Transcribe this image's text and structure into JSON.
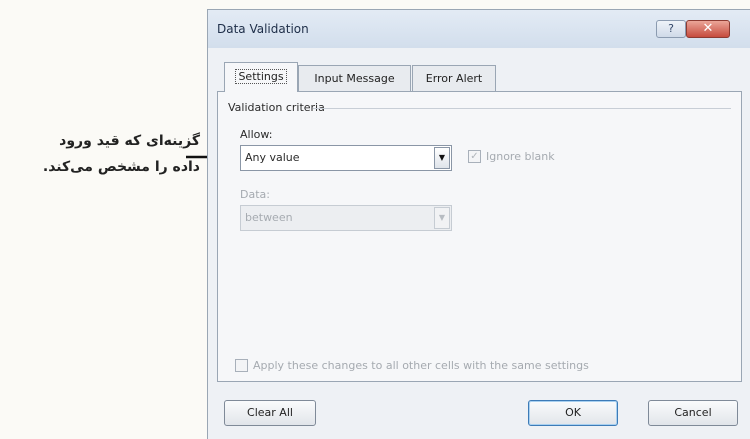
{
  "annotation": {
    "lines": [
      "گزینه‌ای که قید ورود",
      "داده را مشخص می‌کند."
    ]
  },
  "dialog": {
    "title": "Data Validation",
    "help_button": "?",
    "close_button": "✕",
    "tabs": [
      {
        "label": "Settings",
        "active": true
      },
      {
        "label": "Input Message",
        "active": false
      },
      {
        "label": "Error Alert",
        "active": false
      }
    ],
    "settings": {
      "group_label": "Validation criteria",
      "allow_label": "Allow:",
      "allow_value": "Any value",
      "ignore_blank_label": "Ignore blank",
      "ignore_blank_checked": true,
      "data_label": "Data:",
      "data_value": "between",
      "apply_label": "Apply these changes to all other cells with the same settings",
      "apply_checked": false
    },
    "buttons": {
      "clear_all": "Clear All",
      "ok": "OK",
      "cancel": "Cancel"
    }
  },
  "icons": {
    "arrow": "arrow-right-icon",
    "dropdown": "chevron-down-icon",
    "checkbox": "checkbox-icon"
  },
  "colors": {
    "titlebar": "#d2deec",
    "close_button": "#c64b3d",
    "default_button_border": "#3d7bb7"
  }
}
